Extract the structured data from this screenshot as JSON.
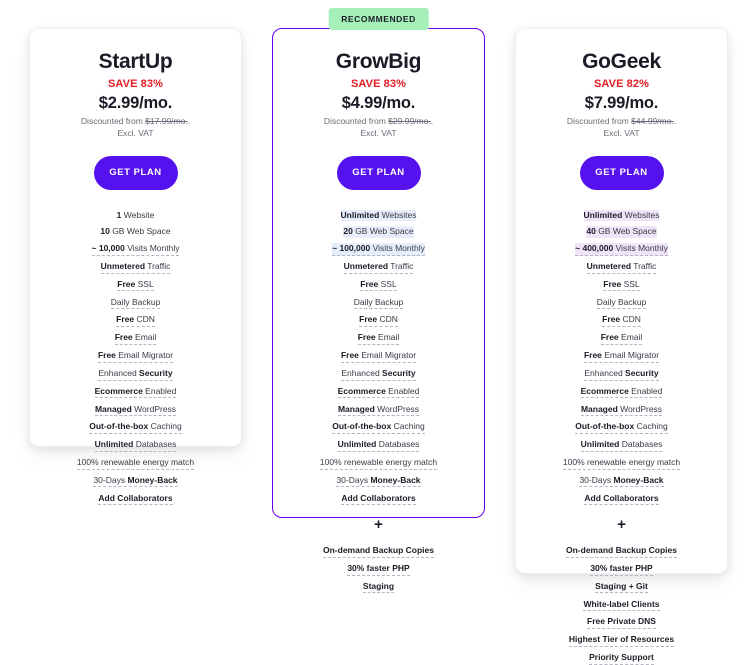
{
  "page": {
    "background": "#ffffff",
    "accent_purple": "#5511EE",
    "featured_border": "#6600EE",
    "save_red": "#e11b22",
    "ribbon_green": "#A5EFB8",
    "highlight_blue": "#e6eefb",
    "highlight_purple": "#efe4f8"
  },
  "plans": [
    {
      "id": "startup",
      "name": "StartUp",
      "save_label": "SAVE 83%",
      "price": "$2.99/mo.",
      "discount_prefix": "Discounted from ",
      "discount_old_price": "$17.99/mo.",
      "discount_suffix": ".",
      "vat_note": "Excl. VAT",
      "cta_label": "GET PLAN",
      "recommended": false,
      "ribbon_label": "",
      "features": [
        {
          "bold": "1",
          "rest": " Website",
          "highlight": "none",
          "rule": false
        },
        {
          "bold": "10",
          "rest": " GB Web Space",
          "highlight": "none",
          "rule": false
        },
        {
          "bold": "~ 10,000",
          "rest": " Visits Monthly",
          "highlight": "none",
          "rule": true
        },
        {
          "bold": "Unmetered",
          "rest": " Traffic",
          "highlight": "none",
          "rule": true
        },
        {
          "bold": "Free",
          "rest": " SSL",
          "highlight": "none",
          "rule": true
        },
        {
          "bold": "",
          "rest": "Daily Backup",
          "highlight": "none",
          "rule": true
        },
        {
          "bold": "Free",
          "rest": " CDN",
          "highlight": "none",
          "rule": true
        },
        {
          "bold": "Free",
          "rest": " Email",
          "highlight": "none",
          "rule": true
        },
        {
          "bold": "Free",
          "rest": " Email Migrator",
          "highlight": "none",
          "rule": true
        },
        {
          "bold": "",
          "rest": "Enhanced ",
          "bold2": "Security",
          "highlight": "none",
          "rule": true
        },
        {
          "bold": "Ecommerce",
          "rest": " Enabled",
          "highlight": "none",
          "rule": true
        },
        {
          "bold": "Managed",
          "rest": " WordPress",
          "highlight": "none",
          "rule": true
        },
        {
          "bold": "Out-of-the-box",
          "rest": " Caching",
          "highlight": "none",
          "rule": true
        },
        {
          "bold": "Unlimited",
          "rest": " Databases",
          "highlight": "none",
          "rule": true
        },
        {
          "bold": "",
          "rest": "100% renewable energy match",
          "highlight": "none",
          "rule": true
        },
        {
          "bold": "",
          "rest": "30-Days ",
          "bold2": "Money-Back",
          "highlight": "none",
          "rule": true
        },
        {
          "bold": "Add Collaborators",
          "rest": "",
          "highlight": "none",
          "rule": true
        }
      ],
      "plus_divider": "",
      "extra_features": []
    },
    {
      "id": "growbig",
      "name": "GrowBig",
      "save_label": "SAVE 83%",
      "price": "$4.99/mo.",
      "discount_prefix": "Discounted from ",
      "discount_old_price": "$29.99/mo.",
      "discount_suffix": ".",
      "vat_note": "Excl. VAT",
      "cta_label": "GET PLAN",
      "recommended": true,
      "ribbon_label": "RECOMMENDED",
      "features": [
        {
          "bold": "Unlimited",
          "rest": " Websites",
          "highlight": "blue",
          "rule": false
        },
        {
          "bold": "20",
          "rest": " GB Web Space",
          "highlight": "blue",
          "rule": false
        },
        {
          "bold": "~ 100,000",
          "rest": " Visits Monthly",
          "highlight": "blue",
          "rule": true
        },
        {
          "bold": "Unmetered",
          "rest": " Traffic",
          "highlight": "none",
          "rule": true
        },
        {
          "bold": "Free",
          "rest": " SSL",
          "highlight": "none",
          "rule": true
        },
        {
          "bold": "",
          "rest": "Daily Backup",
          "highlight": "none",
          "rule": true
        },
        {
          "bold": "Free",
          "rest": " CDN",
          "highlight": "none",
          "rule": true
        },
        {
          "bold": "Free",
          "rest": " Email",
          "highlight": "none",
          "rule": true
        },
        {
          "bold": "Free",
          "rest": " Email Migrator",
          "highlight": "none",
          "rule": true
        },
        {
          "bold": "",
          "rest": "Enhanced ",
          "bold2": "Security",
          "highlight": "none",
          "rule": true
        },
        {
          "bold": "Ecommerce",
          "rest": " Enabled",
          "highlight": "none",
          "rule": true
        },
        {
          "bold": "Managed",
          "rest": " WordPress",
          "highlight": "none",
          "rule": true
        },
        {
          "bold": "Out-of-the-box",
          "rest": " Caching",
          "highlight": "none",
          "rule": true
        },
        {
          "bold": "Unlimited",
          "rest": " Databases",
          "highlight": "none",
          "rule": true
        },
        {
          "bold": "",
          "rest": "100% renewable energy match",
          "highlight": "none",
          "rule": true
        },
        {
          "bold": "",
          "rest": "30-Days ",
          "bold2": "Money-Back",
          "highlight": "none",
          "rule": true
        },
        {
          "bold": "Add Collaborators",
          "rest": "",
          "highlight": "none",
          "rule": true
        }
      ],
      "plus_divider": "+",
      "extra_features": [
        {
          "bold": "On-demand Backup Copies",
          "rest": "",
          "highlight": "none",
          "rule": true
        },
        {
          "bold": "30% faster PHP",
          "rest": "",
          "highlight": "none",
          "rule": true
        },
        {
          "bold": "Staging",
          "rest": "",
          "highlight": "none",
          "rule": true
        }
      ]
    },
    {
      "id": "gogeek",
      "name": "GoGeek",
      "save_label": "SAVE 82%",
      "price": "$7.99/mo.",
      "discount_prefix": "Discounted from ",
      "discount_old_price": "$44.99/mo.",
      "discount_suffix": ".",
      "vat_note": "Excl. VAT",
      "cta_label": "GET PLAN",
      "recommended": false,
      "ribbon_label": "",
      "features": [
        {
          "bold": "Unlimited",
          "rest": " Websites",
          "highlight": "purple",
          "rule": false
        },
        {
          "bold": "40",
          "rest": " GB Web Space",
          "highlight": "purple",
          "rule": false
        },
        {
          "bold": "~ 400,000",
          "rest": " Visits Monthly",
          "highlight": "purple",
          "rule": true
        },
        {
          "bold": "Unmetered",
          "rest": " Traffic",
          "highlight": "none",
          "rule": true
        },
        {
          "bold": "Free",
          "rest": " SSL",
          "highlight": "none",
          "rule": true
        },
        {
          "bold": "",
          "rest": "Daily Backup",
          "highlight": "none",
          "rule": true
        },
        {
          "bold": "Free",
          "rest": " CDN",
          "highlight": "none",
          "rule": true
        },
        {
          "bold": "Free",
          "rest": " Email",
          "highlight": "none",
          "rule": true
        },
        {
          "bold": "Free",
          "rest": " Email Migrator",
          "highlight": "none",
          "rule": true
        },
        {
          "bold": "",
          "rest": "Enhanced ",
          "bold2": "Security",
          "highlight": "none",
          "rule": true
        },
        {
          "bold": "Ecommerce",
          "rest": " Enabled",
          "highlight": "none",
          "rule": true
        },
        {
          "bold": "Managed",
          "rest": " WordPress",
          "highlight": "none",
          "rule": true
        },
        {
          "bold": "Out-of-the-box",
          "rest": " Caching",
          "highlight": "none",
          "rule": true
        },
        {
          "bold": "Unlimited",
          "rest": " Databases",
          "highlight": "none",
          "rule": true
        },
        {
          "bold": "",
          "rest": "100% renewable energy match",
          "highlight": "none",
          "rule": true
        },
        {
          "bold": "",
          "rest": "30-Days ",
          "bold2": "Money-Back",
          "highlight": "none",
          "rule": true
        },
        {
          "bold": "Add Collaborators",
          "rest": "",
          "highlight": "none",
          "rule": true
        }
      ],
      "plus_divider": "+",
      "extra_features": [
        {
          "bold": "On-demand Backup Copies",
          "rest": "",
          "highlight": "none",
          "rule": true
        },
        {
          "bold": "30% faster PHP",
          "rest": "",
          "highlight": "none",
          "rule": true
        },
        {
          "bold": "Staging + Git",
          "rest": "",
          "highlight": "none",
          "rule": true
        },
        {
          "bold": "White-label Clients",
          "rest": "",
          "highlight": "none",
          "rule": true
        },
        {
          "bold": "Free Private DNS",
          "rest": "",
          "highlight": "none",
          "rule": true
        },
        {
          "bold": "Highest Tier of Resources",
          "rest": "",
          "highlight": "none",
          "rule": true
        },
        {
          "bold": "Priority Support",
          "rest": "",
          "highlight": "none",
          "rule": true
        }
      ]
    }
  ]
}
